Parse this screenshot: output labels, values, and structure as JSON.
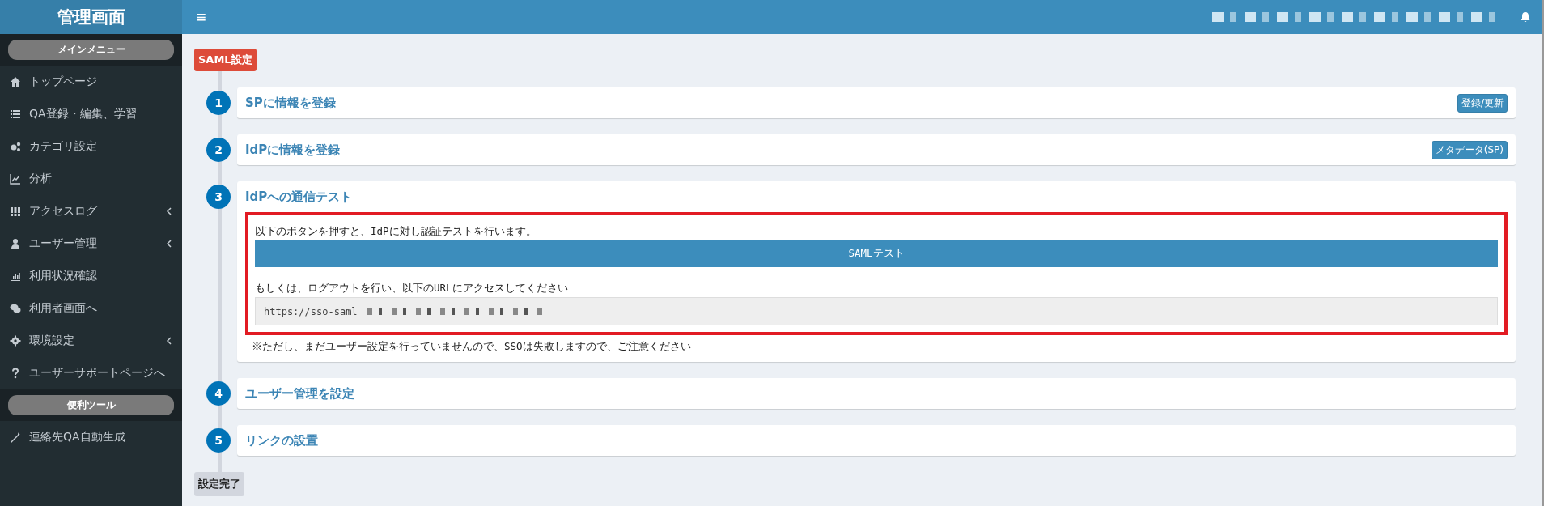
{
  "sidebar": {
    "title": "管理画面",
    "sections": [
      {
        "heading": "メインメニュー",
        "items": [
          {
            "label": "トップページ",
            "has_submenu": false
          },
          {
            "label": "QA登録・編集、学習",
            "has_submenu": false
          },
          {
            "label": "カテゴリ設定",
            "has_submenu": false
          },
          {
            "label": "分析",
            "has_submenu": false
          },
          {
            "label": "アクセスログ",
            "has_submenu": true
          },
          {
            "label": "ユーザー管理",
            "has_submenu": true
          },
          {
            "label": "利用状況確認",
            "has_submenu": false
          },
          {
            "label": "利用者画面へ",
            "has_submenu": false
          },
          {
            "label": "環境設定",
            "has_submenu": true
          },
          {
            "label": "ユーザーサポートページへ",
            "has_submenu": false
          }
        ]
      },
      {
        "heading": "便利ツール",
        "items": [
          {
            "label": "連絡先QA自動生成",
            "has_submenu": false
          }
        ]
      }
    ]
  },
  "header": {
    "menu_icon": "≡"
  },
  "page": {
    "badge": "SAML設定",
    "steps": [
      {
        "number": "1",
        "title": "SPに情報を登録",
        "button": "登録/更新"
      },
      {
        "number": "2",
        "title": "IdPに情報を登録",
        "button": "メタデータ(SP)"
      },
      {
        "number": "3",
        "title": "IdPへの通信テスト",
        "body": {
          "highlighted": true,
          "intro": "以下のボタンを押すと、IdPに対し認証テストを行います。",
          "test_button": "SAMLテスト",
          "alt_text": "もしくは、ログアウトを行い、以下のURLにアクセスしてください",
          "url": "https://sso-saml",
          "note": "※ただし、まだユーザー設定を行っていませんので、SSOは失敗しますので、ご注意ください"
        }
      },
      {
        "number": "4",
        "title": "ユーザー管理を設定"
      },
      {
        "number": "5",
        "title": "リンクの設置"
      }
    ],
    "finish": "設定完了"
  }
}
